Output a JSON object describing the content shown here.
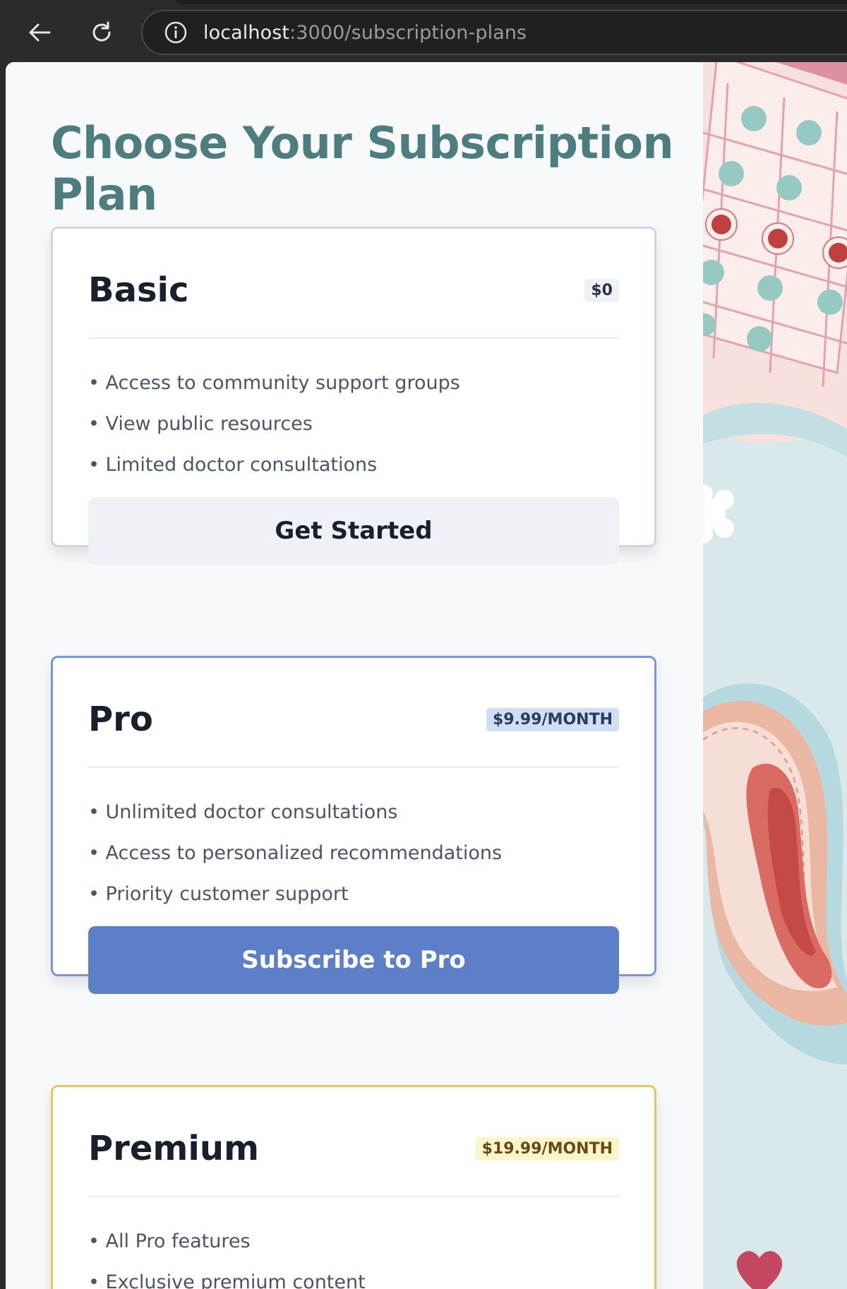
{
  "browser": {
    "url_host": "localhost",
    "url_path": ":3000/subscription-plans"
  },
  "page": {
    "title": "Choose Your Subscription Plan"
  },
  "plans": [
    {
      "name": "Basic",
      "price": "$0",
      "features": [
        "Access to community support groups",
        "View public resources",
        "Limited doctor consultations"
      ],
      "cta": "Get Started"
    },
    {
      "name": "Pro",
      "price": "$9.99/MONTH",
      "features": [
        "Unlimited doctor consultations",
        "Access to personalized recommendations",
        "Priority customer support"
      ],
      "cta": "Subscribe to Pro"
    },
    {
      "name": "Premium",
      "price": "$19.99/MONTH",
      "features": [
        "All Pro features",
        "Exclusive premium content"
      ]
    }
  ],
  "colors": {
    "title": "#4d7d7e",
    "pro_accent": "#5c7fc8",
    "premium_accent": "#e2c95c"
  }
}
